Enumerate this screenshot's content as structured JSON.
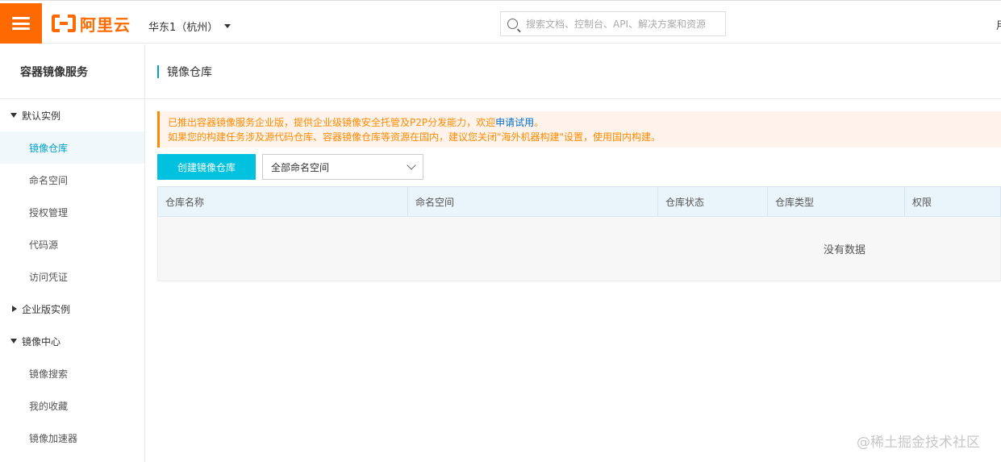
{
  "header": {
    "logo_text": "阿里云",
    "region": "华东1（杭州）",
    "search_placeholder": "搜索文档、控制台、API、解决方案和资源",
    "right_cut_text": "用"
  },
  "sidebar": {
    "title": "容器镜像服务",
    "groups": [
      {
        "label": "默认实例",
        "expanded": true,
        "items": [
          "镜像仓库",
          "命名空间",
          "授权管理",
          "代码源",
          "访问凭证"
        ]
      },
      {
        "label": "企业版实例",
        "expanded": false,
        "items": []
      },
      {
        "label": "镜像中心",
        "expanded": true,
        "items": [
          "镜像搜索",
          "我的收藏",
          "镜像加速器"
        ]
      }
    ],
    "active_item": "镜像仓库"
  },
  "main": {
    "page_title": "镜像仓库",
    "notice": {
      "line1_prefix": "已推出容器镜像服务企业版，提供企业级镜像安全托管及P2P分发能力，欢迎",
      "line1_link": "申请试用",
      "line1_suffix": "。",
      "line2": "如果您的构建任务涉及源代码仓库、容器镜像仓库等资源在国内，建议您关闭\"海外机器构建\"设置，使用国内构建。"
    },
    "create_button": "创建镜像仓库",
    "namespace_select": "全部命名空间",
    "table": {
      "columns": [
        "仓库名称",
        "命名空间",
        "仓库状态",
        "仓库类型",
        "权限"
      ],
      "empty_text": "没有数据"
    }
  },
  "watermark": "@稀土掘金技术社区",
  "colors": {
    "brand": "#ff6a00",
    "accent": "#00c1de",
    "notice": "#ff8a00",
    "link": "#0070cc"
  }
}
